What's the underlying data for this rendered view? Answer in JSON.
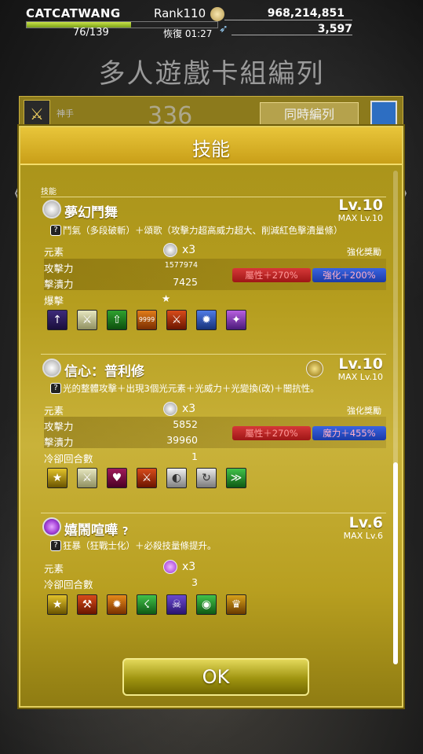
{
  "status": {
    "player_name": "CATCATWANG",
    "rank": "Rank110",
    "gold": "968,214,851",
    "stamina": "76/139",
    "stamina_fraction": 0.547,
    "recover": "恢復 01:27",
    "gems": "3,597"
  },
  "background": {
    "title": "多人遊戲卡組編列",
    "card_label": "神手",
    "card_number": "336",
    "sync_button": "同時編列",
    "arrow_left": "《",
    "arrow_right": "》"
  },
  "modal": {
    "title": "技能",
    "section_header": "技能",
    "ok_button": "OK"
  },
  "skills": [
    {
      "name": "夢幻鬥舞",
      "lv": "Lv.10",
      "max_lv": "MAX Lv.10",
      "desc": "鬥氣（多段破斬）＋頌歌（攻擊力超高威力超大、削減紅色擊潰量條）",
      "element_label": "元素",
      "element_count": "x3",
      "bonus_label": "強化獎勵",
      "attack_label": "攻擊力",
      "attack_value": "1577974",
      "break_label": "擊潰力",
      "break_value": "7425",
      "extra_label": "爆擊",
      "extra_value": "★",
      "badge_red": "屬性＋270%",
      "badge_blue": "強化＋200%"
    },
    {
      "name": "信心：普利修",
      "lv": "Lv.10",
      "max_lv": "MAX Lv.10",
      "desc": "光的整體攻擊＋出現3個光元素＋光威力＋光變換(改)＋闇抗性。",
      "element_label": "元素",
      "element_count": "x3",
      "bonus_label": "強化獎勵",
      "attack_label": "攻擊力",
      "attack_value": "5852",
      "break_label": "擊潰力",
      "break_value": "39960",
      "extra_label": "冷卻回合數",
      "extra_value": "1",
      "badge_red": "屬性＋270%",
      "badge_blue": "魔力＋455%"
    },
    {
      "name": "嬉鬧喧嘩",
      "name_suffix": "?",
      "lv": "Lv.6",
      "max_lv": "MAX Lv.6",
      "desc": "狂暴（狂戰士化）＋必殺技量條提升。",
      "element_label": "元素",
      "element_count": "x3",
      "cooldown_label": "冷卻回合數",
      "cooldown_value": "3"
    }
  ],
  "icon_names": [
    "attack-up-icon",
    "sword-icon",
    "arrow-up-icon",
    "combo-9999-icon",
    "slash-icon",
    "burst-icon",
    "magic-icon",
    "stars-icon",
    "heart-shield-icon",
    "flame-sword-icon",
    "light-wave-icon",
    "light-spin-icon",
    "speed-icon",
    "rage-icon",
    "runner-icon",
    "skull-icon",
    "orb-icon",
    "helmet-icon"
  ],
  "colors": {
    "modal_gold": "#b59d1e",
    "badge_red": "#d63838",
    "badge_blue": "#3a64e0",
    "stamina_green": "#9fc22a"
  }
}
